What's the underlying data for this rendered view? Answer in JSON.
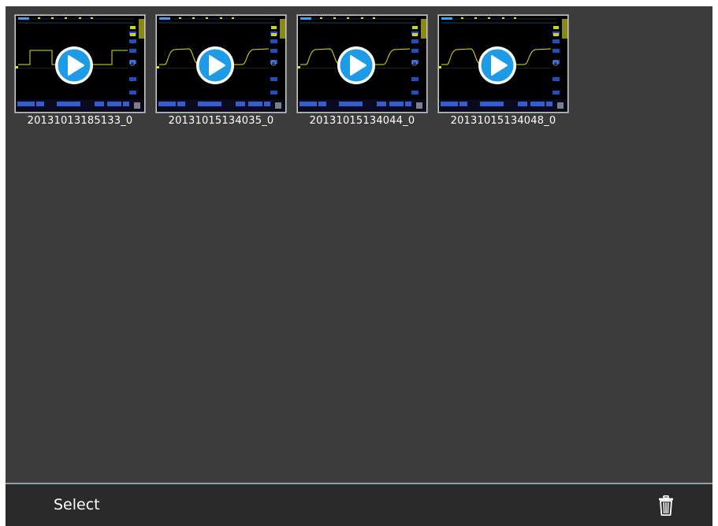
{
  "gallery": {
    "items": [
      {
        "filename": "20131013185133_0",
        "waveform": "square"
      },
      {
        "filename": "20131015134035_0",
        "waveform": "smooth"
      },
      {
        "filename": "20131015134044_0",
        "waveform": "smooth"
      },
      {
        "filename": "20131015134048_0",
        "waveform": "smooth"
      }
    ]
  },
  "footer": {
    "select_label": "Select",
    "delete_icon": "trash-icon"
  },
  "colors": {
    "background": "#3d3c3c",
    "footer": "#2b2a2a",
    "play_button": "#1e9be6",
    "trace": "#e6e600",
    "ui_accent": "#3a6ef0"
  }
}
